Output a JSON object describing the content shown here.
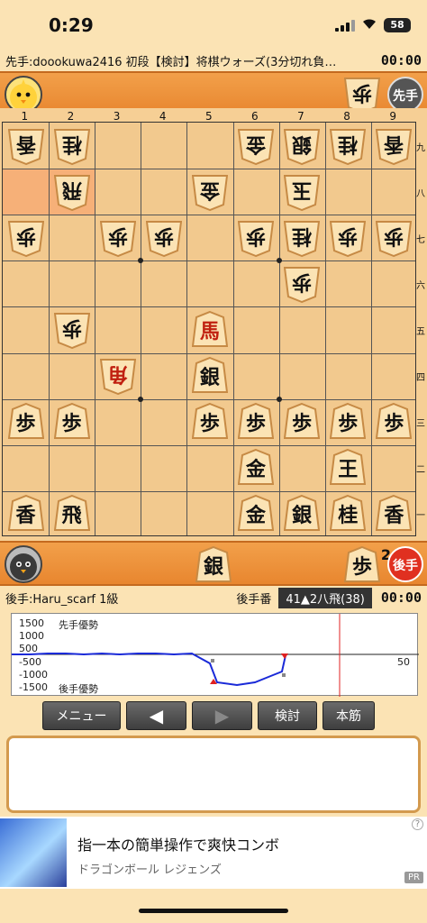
{
  "status_bar": {
    "time": "0:29",
    "battery": "58"
  },
  "title_bar": {
    "text": "先手:doookuwa2416 初段【検討】将棋ウォーズ(3分切れ負…",
    "time": "00:00"
  },
  "sente": {
    "badge": "先手",
    "hand": [
      "歩"
    ]
  },
  "gote": {
    "badge": "後手",
    "hand": [
      "銀",
      "歩"
    ],
    "pawn_count": "2"
  },
  "board": {
    "files": [
      "1",
      "2",
      "3",
      "4",
      "5",
      "6",
      "7",
      "8",
      "9"
    ],
    "ranks": [
      "九",
      "八",
      "七",
      "六",
      "五",
      "四",
      "三",
      "二",
      "一"
    ],
    "highlights": [
      [
        0,
        1
      ],
      [
        1,
        1
      ]
    ],
    "pieces": [
      {
        "c": 0,
        "r": 0,
        "k": "香",
        "o": "g"
      },
      {
        "c": 1,
        "r": 0,
        "k": "桂",
        "o": "g"
      },
      {
        "c": 5,
        "r": 0,
        "k": "金",
        "o": "g"
      },
      {
        "c": 6,
        "r": 0,
        "k": "銀",
        "o": "g"
      },
      {
        "c": 7,
        "r": 0,
        "k": "桂",
        "o": "g"
      },
      {
        "c": 8,
        "r": 0,
        "k": "香",
        "o": "g"
      },
      {
        "c": 1,
        "r": 1,
        "k": "飛",
        "o": "g"
      },
      {
        "c": 4,
        "r": 1,
        "k": "金",
        "o": "g"
      },
      {
        "c": 6,
        "r": 1,
        "k": "玉",
        "o": "g"
      },
      {
        "c": 0,
        "r": 2,
        "k": "歩",
        "o": "g"
      },
      {
        "c": 2,
        "r": 2,
        "k": "歩",
        "o": "g"
      },
      {
        "c": 3,
        "r": 2,
        "k": "歩",
        "o": "g"
      },
      {
        "c": 5,
        "r": 2,
        "k": "歩",
        "o": "g"
      },
      {
        "c": 6,
        "r": 2,
        "k": "桂",
        "o": "g"
      },
      {
        "c": 7,
        "r": 2,
        "k": "歩",
        "o": "g"
      },
      {
        "c": 8,
        "r": 2,
        "k": "歩",
        "o": "g"
      },
      {
        "c": 6,
        "r": 3,
        "k": "歩",
        "o": "g"
      },
      {
        "c": 1,
        "r": 4,
        "k": "歩",
        "o": "g"
      },
      {
        "c": 4,
        "r": 4,
        "k": "馬",
        "o": "s",
        "p": true
      },
      {
        "c": 2,
        "r": 5,
        "k": "角",
        "o": "g",
        "p": true
      },
      {
        "c": 4,
        "r": 5,
        "k": "銀",
        "o": "s"
      },
      {
        "c": 0,
        "r": 6,
        "k": "歩",
        "o": "s"
      },
      {
        "c": 1,
        "r": 6,
        "k": "歩",
        "o": "s"
      },
      {
        "c": 4,
        "r": 6,
        "k": "歩",
        "o": "s"
      },
      {
        "c": 5,
        "r": 6,
        "k": "歩",
        "o": "s"
      },
      {
        "c": 6,
        "r": 6,
        "k": "歩",
        "o": "s"
      },
      {
        "c": 7,
        "r": 6,
        "k": "歩",
        "o": "s"
      },
      {
        "c": 8,
        "r": 6,
        "k": "歩",
        "o": "s"
      },
      {
        "c": 5,
        "r": 7,
        "k": "金",
        "o": "s"
      },
      {
        "c": 7,
        "r": 7,
        "k": "王",
        "o": "s"
      },
      {
        "c": 0,
        "r": 8,
        "k": "香",
        "o": "s"
      },
      {
        "c": 1,
        "r": 8,
        "k": "飛",
        "o": "s"
      },
      {
        "c": 5,
        "r": 8,
        "k": "金",
        "o": "s"
      },
      {
        "c": 6,
        "r": 8,
        "k": "銀",
        "o": "s"
      },
      {
        "c": 7,
        "r": 8,
        "k": "桂",
        "o": "s"
      },
      {
        "c": 8,
        "r": 8,
        "k": "香",
        "o": "s"
      }
    ]
  },
  "info_row": {
    "gote_name": "後手:Haru_scarf 1級",
    "turn": "後手番",
    "move": "41▲2八飛(38)",
    "time": "00:00"
  },
  "eval_graph": {
    "labels": {
      "y1500": "1500",
      "y1000": "1000",
      "y500": "500",
      "ym500": "-500",
      "ym1000": "-1000",
      "ym1500": "-1500",
      "sente_adv": "先手優勢",
      "gote_adv": "後手優勢",
      "x50": "50"
    },
    "line_color": "#1a2ad8",
    "cursor_color": "#e02020"
  },
  "controls": {
    "menu": "メニュー",
    "prev": "◀",
    "next": "▶",
    "kento": "検討",
    "honsuji": "本筋"
  },
  "ad": {
    "title": "指一本の簡単操作で爽快コンボ",
    "subtitle": "ドラゴンボール レジェンズ",
    "info": "?",
    "pr": "PR"
  }
}
